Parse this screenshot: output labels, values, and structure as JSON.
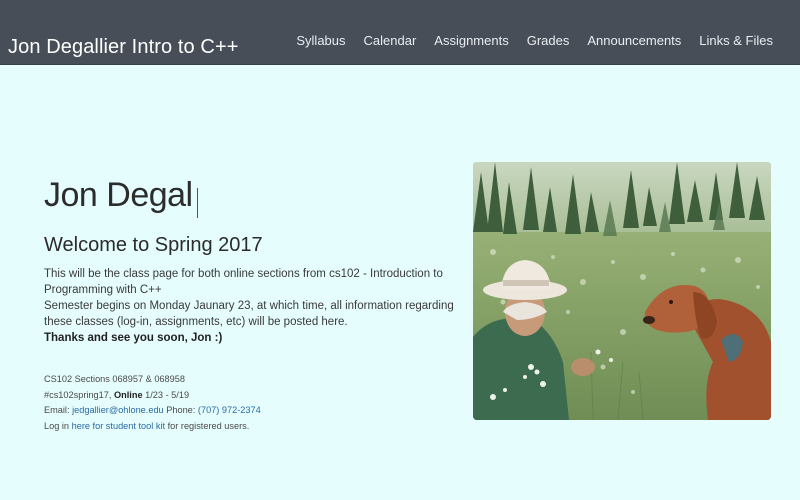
{
  "header": {
    "title": "Jon Degallier Intro to C++",
    "nav": [
      "Syllabus",
      "Calendar",
      "Assignments",
      "Grades",
      "Announcements",
      "Links & Files"
    ]
  },
  "main": {
    "name_heading": "Jon Degal",
    "welcome": "Welcome to Spring 2017",
    "intro_line1": "This will be the class page for both online sections from cs102 - Introduction to Programming with C++",
    "intro_line2": "Semester begins on Monday Jaunary 23, at which time, all information regarding these classes (log-in, assignments, etc) will be posted here.",
    "thanks": "Thanks and see you soon, Jon :)",
    "sections": "CS102 Sections 068957 & 068958",
    "hashtag": "#cs102spring17, ",
    "online_label": "Online",
    "dates": " 1/23 - 5/19",
    "email_label": "Email: ",
    "email": "jedgallier@ohlone.edu",
    "phone_label": " Phone: ",
    "phone": "(707) 972-2374",
    "login_prefix": "Log in ",
    "login_link": "here for student tool kit",
    "login_suffix": " for registered users."
  }
}
